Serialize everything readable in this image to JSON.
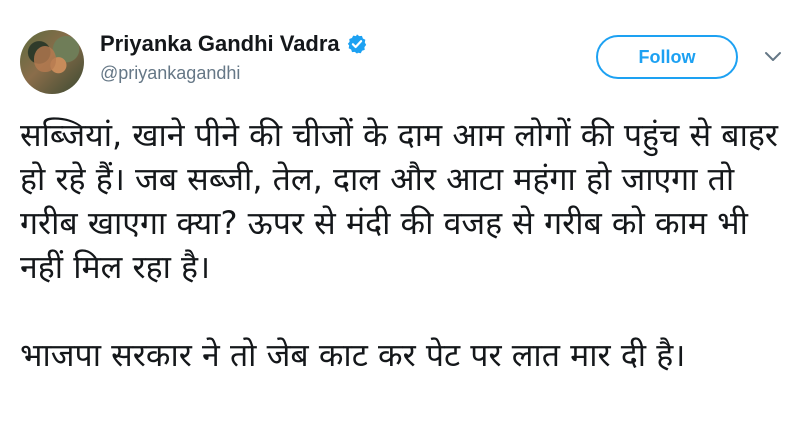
{
  "tweet": {
    "author": {
      "display_name": "Priyanka Gandhi Vadra",
      "handle": "@priyankagandhi",
      "verified": true
    },
    "follow_label": "Follow",
    "paragraphs": [
      "सब्जियां, खाने पीने की चीजों के दाम आम लोगों की पहुंच से बाहर हो रहे हैं। जब सब्जी, तेल, दाल और आटा महंगा हो जाएगा तो गरीब खाएगा क्या? ऊपर से मंदी की वजह से गरीब को काम भी नहीं मिल रहा है।",
      "भाजपा सरकार ने तो जेब काट कर पेट पर लात मार दी है।"
    ]
  },
  "colors": {
    "accent": "#1da1f2",
    "text": "#14171a",
    "secondary": "#657786"
  },
  "icons": {
    "verified": "verified-badge-icon",
    "more": "chevron-down-icon"
  }
}
